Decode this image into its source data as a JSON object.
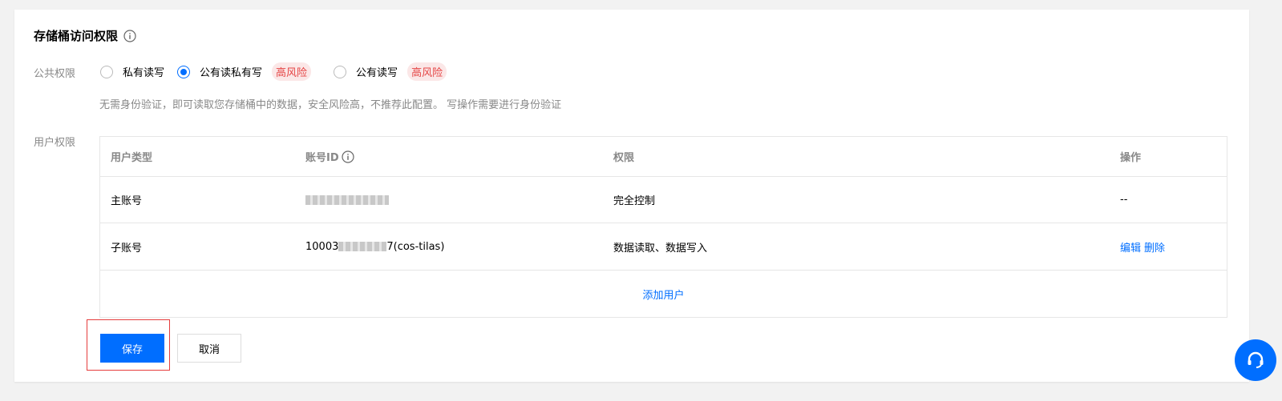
{
  "section": {
    "title": "存储桶访问权限"
  },
  "public_permission": {
    "label": "公共权限",
    "options": [
      {
        "label": "私有读写",
        "checked": false
      },
      {
        "label": "公有读私有写",
        "checked": true,
        "badge": "高风险"
      },
      {
        "label": "公有读写",
        "checked": false,
        "badge": "高风险"
      }
    ],
    "hint": "无需身份验证，即可读取您存储桶中的数据，安全风险高，不推荐此配置。 写操作需要进行身份验证"
  },
  "user_permission": {
    "label": "用户权限",
    "headers": {
      "user_type": "用户类型",
      "account_id": "账号ID",
      "permission": "权限",
      "action": "操作"
    },
    "rows": [
      {
        "user_type": "主账号",
        "account_id_masked": true,
        "permission": "完全控制",
        "action": "--"
      },
      {
        "user_type": "子账号",
        "account_id_prefix": "10003",
        "account_id_suffix": "7(cos-tilas)",
        "permission": "数据读取、数据写入",
        "edit": "编辑",
        "delete": "删除"
      }
    ],
    "add_user": "添加用户"
  },
  "buttons": {
    "save": "保存",
    "cancel": "取消"
  },
  "colors": {
    "accent": "#006eff",
    "risk": "#e54545",
    "highlight": "#e53d3d"
  }
}
